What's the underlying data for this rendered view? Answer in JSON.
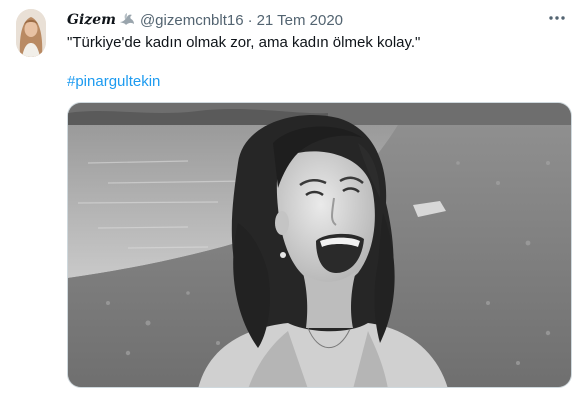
{
  "tweet": {
    "display_name": "Gizem",
    "handle": "@gizemcnblt16",
    "separator": "·",
    "date": "21 Tem 2020",
    "text": "\"Türkiye'de kadın olmak zor, ama kadın ölmek kolay.\"",
    "hashtag": "#pinargultekin"
  },
  "icons": {
    "name_emoji": "dove-icon",
    "more": "more-icon",
    "avatar": "avatar-image",
    "media": "photo-image"
  },
  "colors": {
    "link": "#1d9bf0",
    "secondary_text": "#536471",
    "primary_text": "#0f1419",
    "border": "#cfd9de"
  }
}
